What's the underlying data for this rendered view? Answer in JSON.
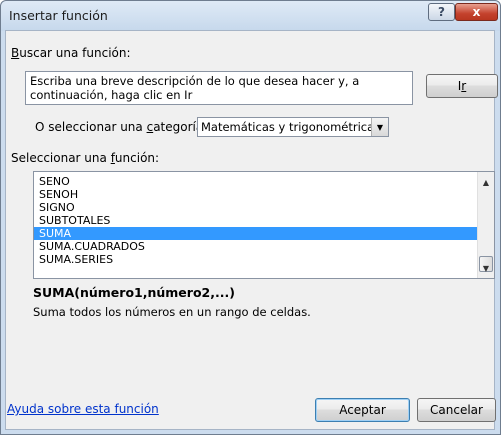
{
  "window": {
    "title": "Insertar función",
    "help_glyph": "?",
    "close_glyph": "x"
  },
  "search": {
    "label_first": "B",
    "label_rest": "uscar una función:",
    "text_line1": "Escriba una breve descripción de lo que desea hacer y, a",
    "text_line2": "continuación, haga clic en Ir",
    "go_label_first": "I",
    "go_label_underlined": "r"
  },
  "category": {
    "label_before": "O seleccionar una ",
    "label_underlined": "c",
    "label_after": "ategoría:",
    "selected": "Matemáticas y trigonométricas"
  },
  "function_list": {
    "label_before": "Seleccionar una ",
    "label_underlined": "f",
    "label_after": "unción:",
    "items": [
      "SENO",
      "SENOH",
      "SIGNO",
      "SUBTOTALES",
      "SUMA",
      "SUMA.CUADRADOS",
      "SUMA.SERIES"
    ],
    "selected_index": 4
  },
  "selected_function": {
    "syntax": "SUMA(número1,número2,...)",
    "description": "Suma todos los números en un rango de celdas."
  },
  "footer": {
    "help_link": "Ayuda sobre esta función",
    "ok_label": "Aceptar",
    "cancel_label": "Cancelar"
  },
  "colors": {
    "selection": "#3399ff",
    "link": "#0033cc",
    "close_button": "#c4422d"
  }
}
